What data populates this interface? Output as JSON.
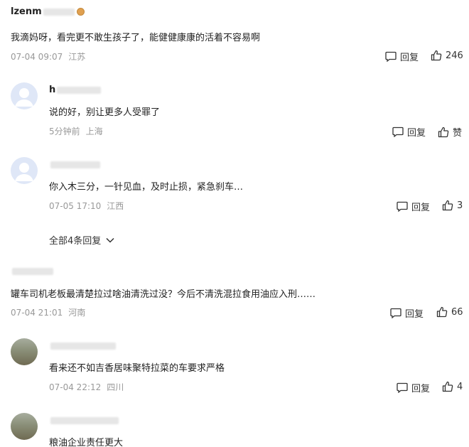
{
  "comments": [
    {
      "user": "lzenm",
      "text": "我滴妈呀，看完更不敢生孩子了，能健健康康的活着不容易啊",
      "date": "07-04 09:07",
      "location": "江苏",
      "reply_label": "回复",
      "like_label": "246"
    },
    {
      "user": "h",
      "text": "说的好，别让更多人受罪了",
      "date": "5分钟前",
      "location": "上海",
      "reply_label": "回复",
      "like_label": "赞"
    },
    {
      "user": "",
      "text": "你入木三分，一针见血，及时止损，紧急刹车…",
      "date": "07-05 17:10",
      "location": "江西",
      "reply_label": "回复",
      "like_label": "3"
    },
    {
      "user": "",
      "text": "罐车司机老板最清楚拉过啥油清洗过没？今后不清洗混拉食用油应入刑……",
      "date": "07-04 21:01",
      "location": "河南",
      "reply_label": "回复",
      "like_label": "66"
    },
    {
      "user": "",
      "text": "看来还不如吉香居味聚特拉菜的车要求严格",
      "date": "07-04 22:12",
      "location": "四川",
      "reply_label": "回复",
      "like_label": "4"
    },
    {
      "user": "",
      "text": "粮油企业责任更大"
    }
  ],
  "replies_toggle": "全部4条回复",
  "icons": {
    "reply": "comment-bubble-icon",
    "like": "thumbs-up-icon",
    "expand": "chevron-down-icon",
    "badge": "hexagon-badge-icon"
  }
}
